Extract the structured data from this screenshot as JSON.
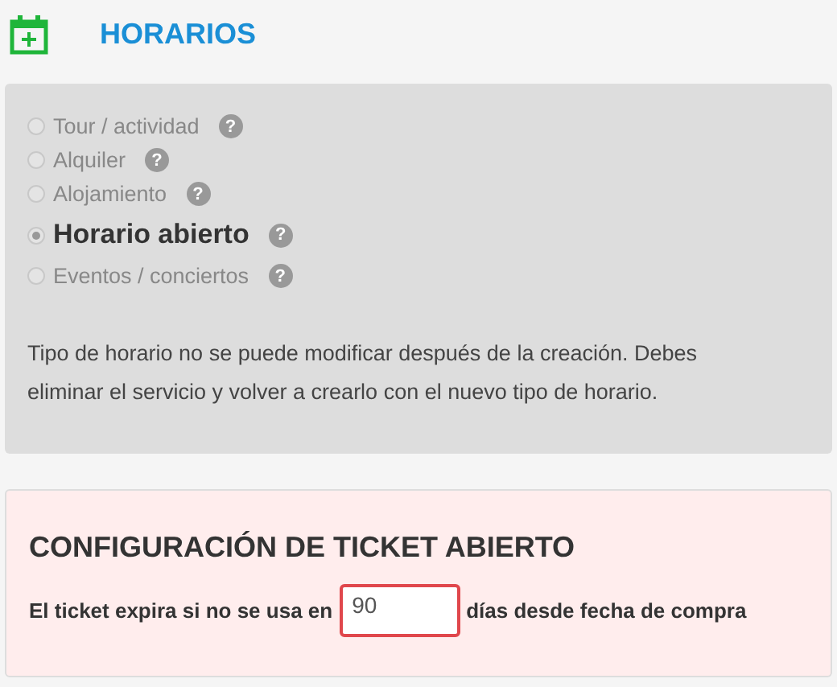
{
  "header": {
    "title": "HORARIOS"
  },
  "schedule_types": [
    {
      "label": "Tour / actividad",
      "selected": false
    },
    {
      "label": "Alquiler",
      "selected": false
    },
    {
      "label": "Alojamiento",
      "selected": false
    },
    {
      "label": "Horario abierto",
      "selected": true
    },
    {
      "label": "Eventos / conciertos",
      "selected": false
    }
  ],
  "help_mark": "?",
  "note": "Tipo de horario no se puede modificar después de la creación. Debes eliminar el servicio y volver a crearlo con el nuevo tipo de horario.",
  "open_ticket": {
    "title": "CONFIGURACIÓN DE TICKET ABIERTO",
    "label_before": "El ticket expira si no se usa en",
    "value": "90",
    "error": true,
    "label_after": "días desde fecha de compra"
  }
}
